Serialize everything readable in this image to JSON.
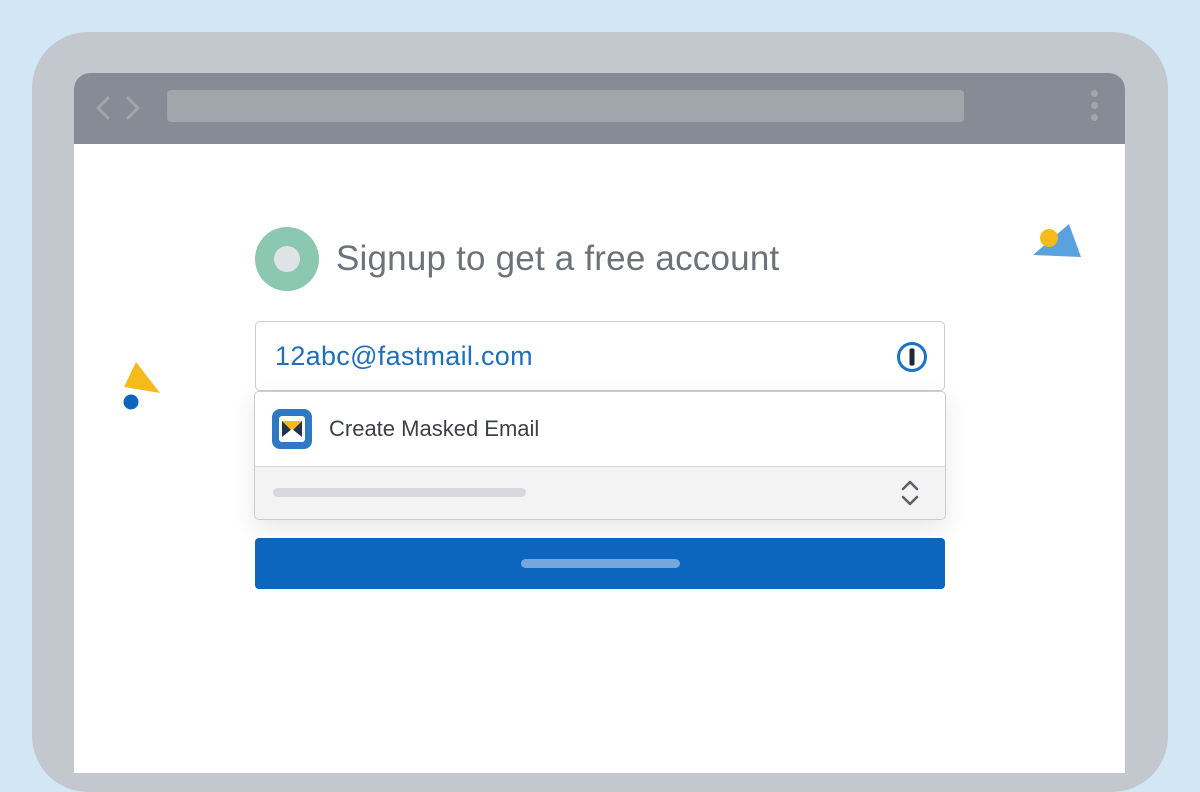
{
  "signup": {
    "title": "Signup to get a free account",
    "email_value": "12abc@fastmail.com"
  },
  "dropdown": {
    "option_label": "Create Masked Email"
  },
  "icons": {
    "back": "chevron-left-icon",
    "forward": "chevron-right-icon",
    "menu": "more-vertical-icon",
    "password_manager": "1password-icon",
    "app": "fastmail-icon",
    "select": "up-down-chevron-icon"
  },
  "colors": {
    "page_background": "#d3e6f5",
    "toolbar": "#868c95",
    "logo": "#8cc7b2",
    "email_text": "#1f6fbc",
    "submit_button": "#0d66bd",
    "accent_yellow": "#f6bb1b",
    "accent_blue": "#5aa2dd"
  }
}
